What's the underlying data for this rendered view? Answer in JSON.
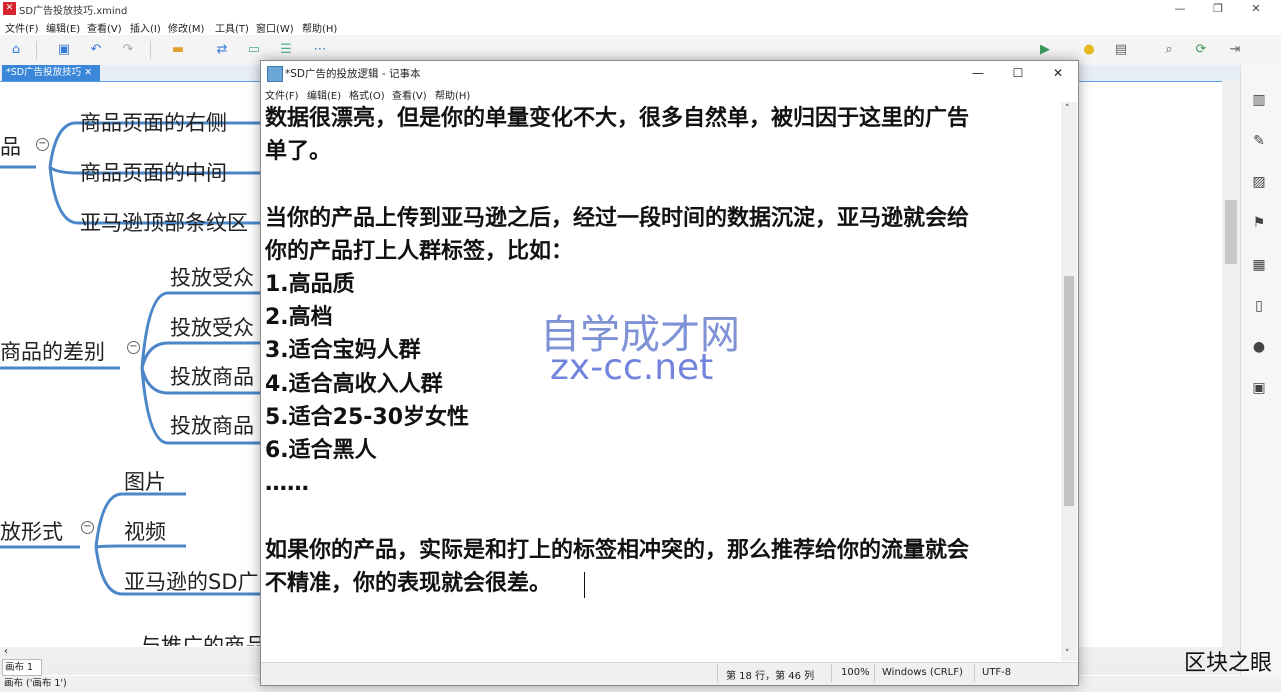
{
  "xmind": {
    "window_title": "SD广告投放技巧.xmind",
    "menu": [
      "文件(F)",
      "编辑(E)",
      "查看(V)",
      "插入(I)",
      "修改(M)",
      "工具(T)",
      "窗口(W)",
      "帮助(H)"
    ],
    "tab": "*SD广告投放技巧",
    "sheet_tab": "画布 1",
    "status": "画布 ('画布 1')",
    "nodes": {
      "n_pin": "品",
      "n_right": "商品页面的右侧",
      "n_mid": "商品页面的中间",
      "n_top": "亚马逊顶部条纹区",
      "n_diff": "商品的差别",
      "n_aud1": "投放受众",
      "n_aud2": "投放受众",
      "n_prod1": "投放商品",
      "n_prod2": "投放商品",
      "n_form": "放形式",
      "n_pic": "图片",
      "n_video": "视频",
      "n_sd": "亚马逊的SD广",
      "n_bottom": "与推广的商品"
    }
  },
  "notepad": {
    "title": "*SD广告的投放逻辑 - 记事本",
    "menu": [
      "文件(F)",
      "编辑(E)",
      "格式(O)",
      "查看(V)",
      "帮助(H)"
    ],
    "lines": [
      "数据很漂亮，但是你的单量变化不大，很多自然单，被归因于这里的广告",
      "单了。",
      "",
      "当你的产品上传到亚马逊之后，经过一段时间的数据沉淀，亚马逊就会给",
      "你的产品打上人群标签，比如：",
      "1.高品质",
      "2.高档",
      "3.适合宝妈人群",
      "4.适合高收入人群",
      "5.适合25-30岁女性",
      "6.适合黑人",
      "……",
      "",
      "如果你的产品，实际是和打上的标签相冲突的，那么推荐给你的流量就会",
      "不精准，你的表现就会很差。"
    ],
    "status": {
      "position": "第 18 行，第 46 列",
      "zoom": "100%",
      "line_ending": "Windows (CRLF)",
      "encoding": "UTF-8"
    }
  },
  "watermark": {
    "name": "自学成才网",
    "url": "zx-cc.net",
    "corner": "区块之眼"
  }
}
